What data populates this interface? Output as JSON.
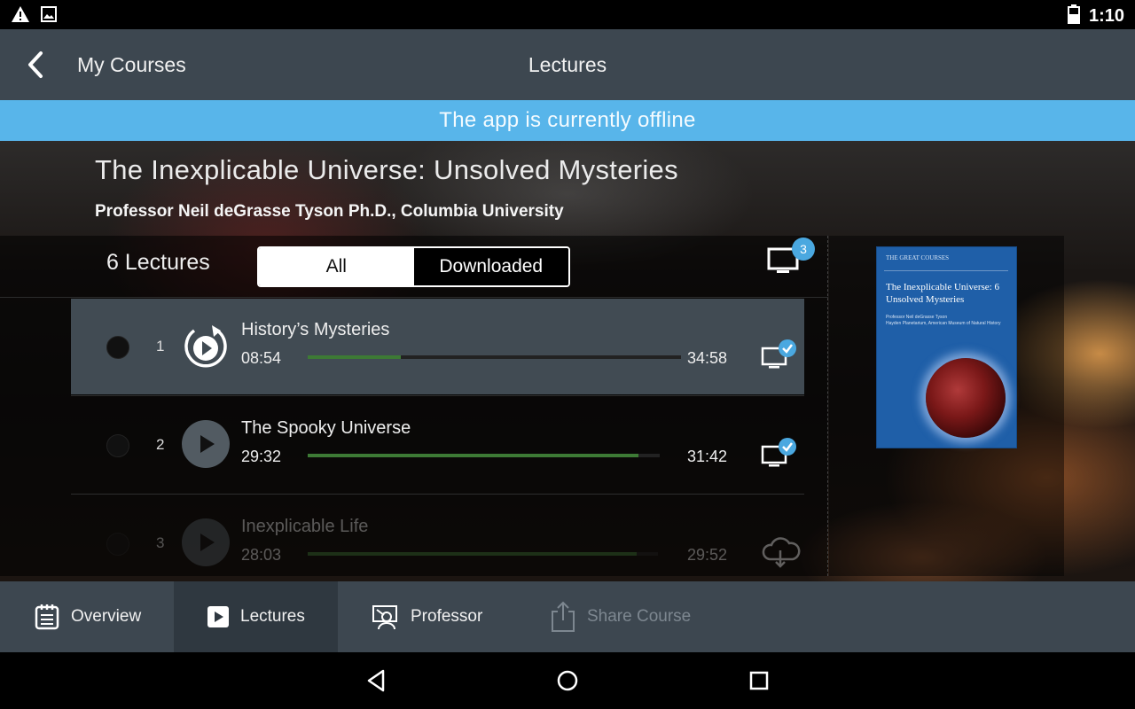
{
  "status_bar": {
    "time": "1:10",
    "icons": [
      "warning-icon",
      "image-icon",
      "battery-icon"
    ]
  },
  "appbar": {
    "back_label": "My Courses",
    "title": "Lectures"
  },
  "offline_banner": "The app is currently offline",
  "course": {
    "title": "The Inexplicable Universe: Unsolved Mysteries",
    "professor": "Professor Neil deGrasse Tyson Ph.D., Columbia University",
    "lecture_count_label": "6 Lectures"
  },
  "filter": {
    "options": [
      "All",
      "Downloaded"
    ],
    "selected": "All"
  },
  "cast_badge_count": "3",
  "lectures": [
    {
      "number": "1",
      "title": "History’s Mysteries",
      "elapsed": "08:54",
      "duration": "34:58",
      "progress": 0.25,
      "status_icon": "screen-check-icon",
      "active": true
    },
    {
      "number": "2",
      "title": "The Spooky Universe",
      "elapsed": "29:32",
      "duration": "31:42",
      "progress": 0.94,
      "status_icon": "screen-check-icon",
      "active": false
    },
    {
      "number": "3",
      "title": "Inexplicable Life",
      "elapsed": "28:03",
      "duration": "29:52",
      "progress": 0.94,
      "status_icon": "cloud-download-icon",
      "active": false
    }
  ],
  "cover": {
    "brand": "THE GREAT COURSES",
    "title": "The Inexplicable Universe: 6 Unsolved Mysteries",
    "author": "Professor Neil deGrasse Tyson",
    "affiliation": "Hayden Planetarium, American Museum of Natural History"
  },
  "tabs": [
    {
      "label": "Overview",
      "icon": "notepad-icon",
      "selected": false,
      "disabled": false
    },
    {
      "label": "Lectures",
      "icon": "play-square-icon",
      "selected": true,
      "disabled": false
    },
    {
      "label": "Professor",
      "icon": "professor-icon",
      "selected": false,
      "disabled": false
    },
    {
      "label": "Share Course",
      "icon": "share-icon",
      "selected": false,
      "disabled": true
    }
  ],
  "colors": {
    "appbar": "#3d4750",
    "offline_banner": "#58b5ea",
    "progress": "#3d7a35",
    "badge": "#4aa8e0"
  }
}
